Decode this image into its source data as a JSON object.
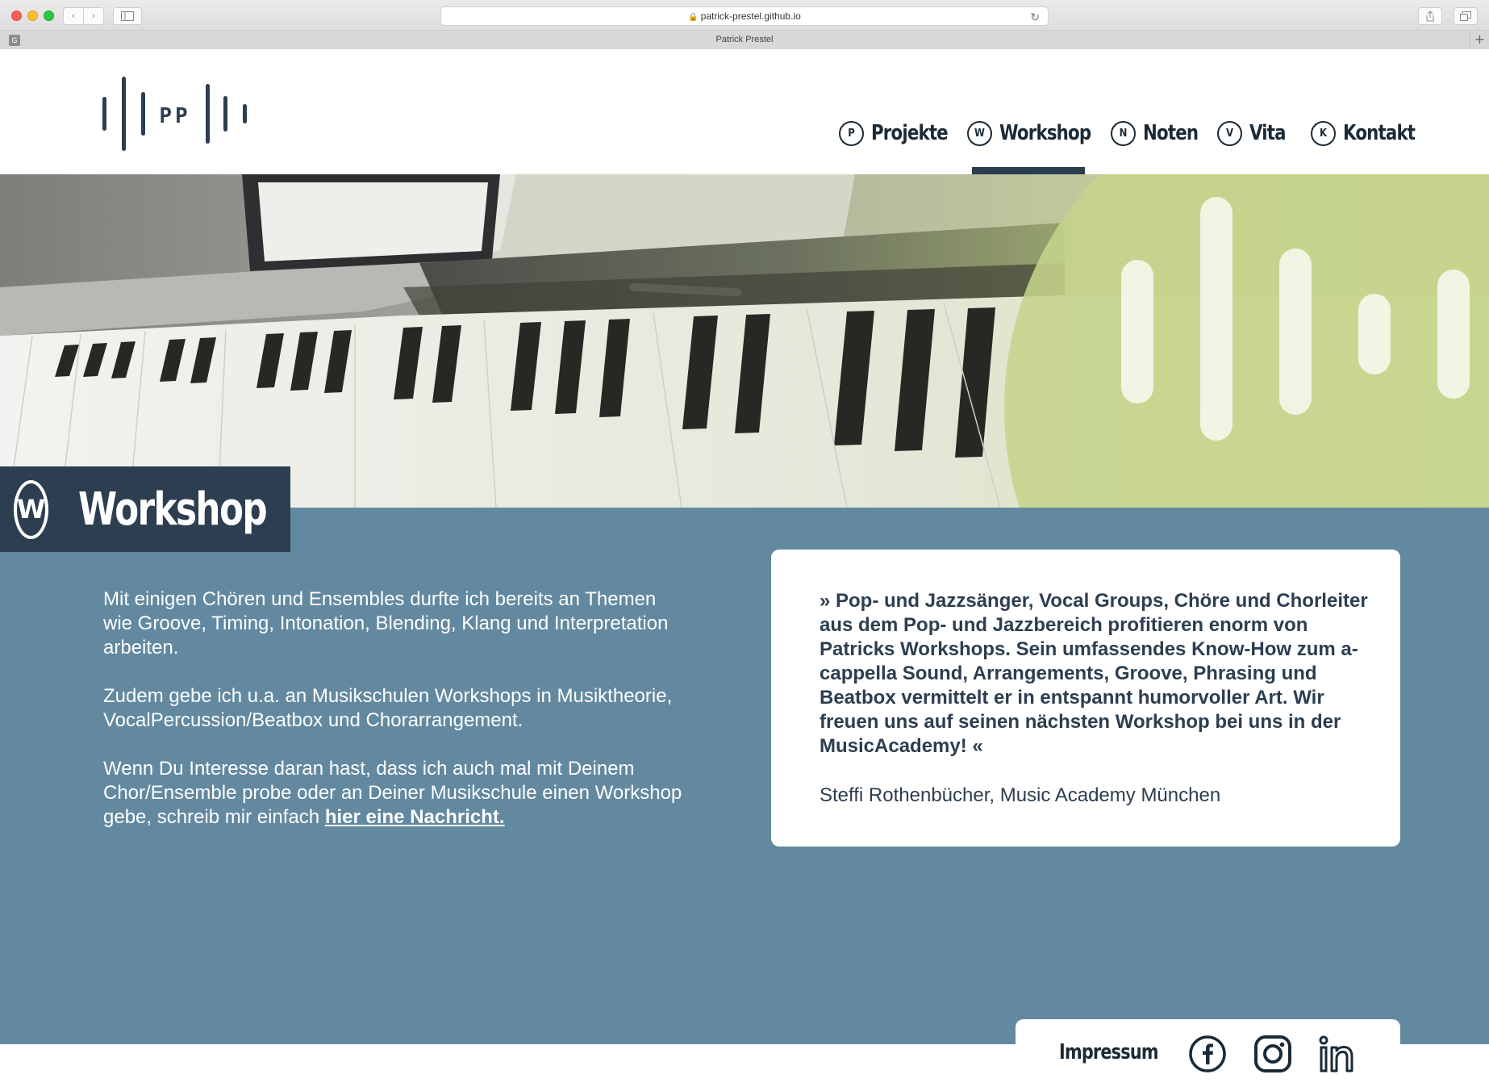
{
  "browser": {
    "url": "patrick-prestel.github.io",
    "tab_title": "Patrick Prestel",
    "tab_favicon": "G",
    "back": "‹",
    "forward": "›",
    "new_tab": "+"
  },
  "nav": {
    "items": [
      {
        "letter": "P",
        "label": "Projekte"
      },
      {
        "letter": "W",
        "label": "Workshop"
      },
      {
        "letter": "N",
        "label": "Noten"
      },
      {
        "letter": "V",
        "label": "Vita"
      },
      {
        "letter": "K",
        "label": "Kontakt"
      }
    ],
    "active": "Workshop"
  },
  "logo": {
    "letters": "PP",
    "color": "#2c3e50"
  },
  "page": {
    "title_letter": "W",
    "title": "Workshop"
  },
  "intro": {
    "p1": "Mit einigen Chören und Ensembles durfte ich bereits an Themen wie Groove, Timing, Intonation, Blending, Klang und Interpretation arbeiten.",
    "p2": "Zudem gebe ich u.a. an Musikschulen Workshops in Musiktheorie, VocalPercussion/Beatbox und Chorarrangement.",
    "p3_prefix": "Wenn Du Interesse daran hast, dass ich auch mal mit Deinem Chor/Ensemble probe oder an Deiner Musikschule einen Workshop gebe, schreib mir einfach ",
    "p3_link": "hier eine Nachricht."
  },
  "quote": {
    "text": "» Pop- und Jazzsänger, Vocal Groups, Chöre und Chorleiter aus dem Pop- und Jazzbereich profitieren enorm von Patricks Workshops. Sein umfassendes Know-How zum a-cappella Sound, Arrangements, Groove, Phrasing und Beatbox vermittelt er in entspannt humorvoller Art. Wir freuen uns auf seinen nächsten Workshop bei uns in der MusicAcademy! «",
    "author": "Steffi Rothenbücher, Music Academy München"
  },
  "footer": {
    "impressum": "Impressum",
    "social": [
      "facebook-icon",
      "instagram-icon",
      "linkedin-icon"
    ]
  },
  "colors": {
    "dark": "#2c3e50",
    "blue": "#62899f",
    "green": "#c5d48b"
  }
}
